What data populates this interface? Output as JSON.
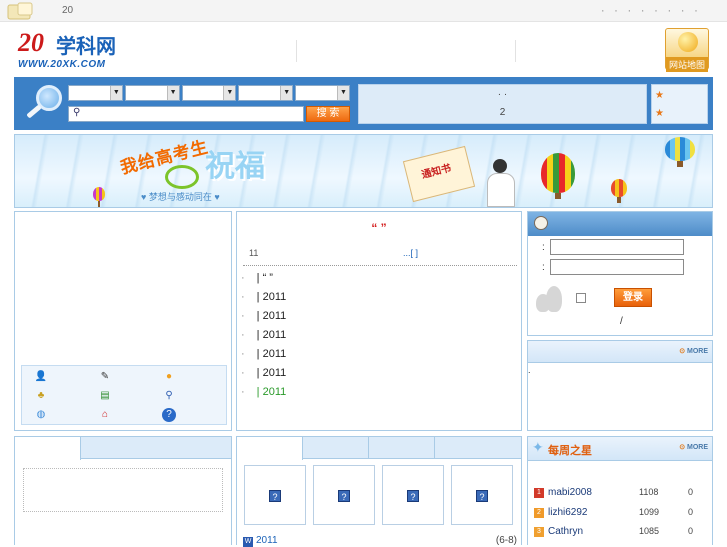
{
  "topbar": {
    "number": "20",
    "dots": "· · · · · · · ·"
  },
  "header": {
    "logo_mark": "20",
    "logo_name": "学科网",
    "logo_url": "WWW.20XK.COM",
    "sitemap_label": "网站地图"
  },
  "search": {
    "selects": [
      "",
      "",
      "",
      "",
      ""
    ],
    "input_value": "",
    "button_label": "搜 索",
    "notice_line1": "·  ·",
    "notice_line2": "2"
  },
  "banner": {
    "slogan": "我给高考生",
    "big_text": "祝福",
    "sub_text": "♥ 梦想与感动同在 ♥",
    "envelope_text": "通知书"
  },
  "news": {
    "title": "“         ”",
    "date": "11",
    "more": "...[  ]",
    "rows": [
      {
        "text": "| “       ”",
        "green": false
      },
      {
        "text": "| 2011",
        "green": false
      },
      {
        "text": "| 2011",
        "green": false
      },
      {
        "text": "| 2011",
        "green": false
      },
      {
        "text": "| 2011",
        "green": false
      },
      {
        "text": "| 2011",
        "green": false
      },
      {
        "text": "| 2011",
        "green": true
      }
    ]
  },
  "login": {
    "user_label": ":",
    "pass_label": ":",
    "login_button": "登录",
    "links_sep": "/"
  },
  "notice_panel": {
    "more": "MORE",
    "dot": "."
  },
  "resources": {
    "thumb_glyph": "?",
    "file_name": "2011",
    "file_range": "(6-8)"
  },
  "weekly_stars": {
    "title": "每周之星",
    "more": "MORE",
    "entries": [
      {
        "rank": "1",
        "name": "mabi2008",
        "points": "1108",
        "zero": "0",
        "color": "#d23a2a"
      },
      {
        "rank": "2",
        "name": "lizhi6292",
        "points": "1099",
        "zero": "0",
        "color": "#f09a2a"
      },
      {
        "rank": "3",
        "name": "Cathryn",
        "points": "1085",
        "zero": "0",
        "color": "#f0a030"
      }
    ]
  },
  "colors": {
    "accent_blue": "#3b80c6",
    "orange": "#ee6a10",
    "red_title": "#d42020"
  }
}
